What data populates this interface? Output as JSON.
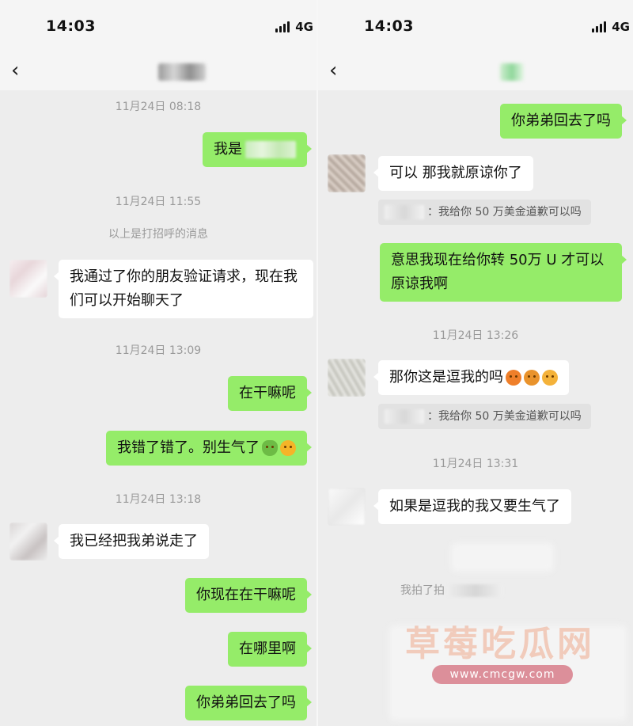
{
  "status": {
    "time": "14:03",
    "network": "4G"
  },
  "left": {
    "nav": {
      "back_icon": "chevron-left-icon"
    },
    "items": {
      "ts1": "11月24日 08:18",
      "me1": "我是",
      "ts2": "11月24日 11:55",
      "sys1": "以上是打招呼的消息",
      "them1": "我通过了你的朋友验证请求，现在我们可以开始聊天了",
      "ts3": "11月24日 13:09",
      "me2": "在干嘛呢",
      "me3": "我错了错了。别生气了",
      "ts4": "11月24日 13:18",
      "them2": "我已经把我弟说走了",
      "me4": "你现在在干嘛呢",
      "me5": "在哪里啊",
      "me6": "你弟弟回去了吗"
    }
  },
  "right": {
    "nav": {
      "back_icon": "chevron-left-icon"
    },
    "items": {
      "me1": "你弟弟回去了吗",
      "them1": "可以 那我就原谅你了",
      "quote1": "：我给你 50 万美金道歉可以吗",
      "me2": "意思我现在给你转 50万 U 才可以原谅我啊",
      "ts1": "11月24日 13:26",
      "them2": "那你这是逗我的吗",
      "quote2": "：我给你 50 万美金道歉可以吗",
      "ts2": "11月24日 13:31",
      "them3": "如果是逗我的我又要生气了",
      "sys1": "我拍了拍"
    }
  },
  "watermark": {
    "title": "草莓吃瓜网",
    "url": "www.cmcgw.com"
  },
  "colors": {
    "background": "#ededed",
    "me_bubble": "#95ec69",
    "them_bubble": "#ffffff",
    "meta_text": "#9a9a9a"
  }
}
